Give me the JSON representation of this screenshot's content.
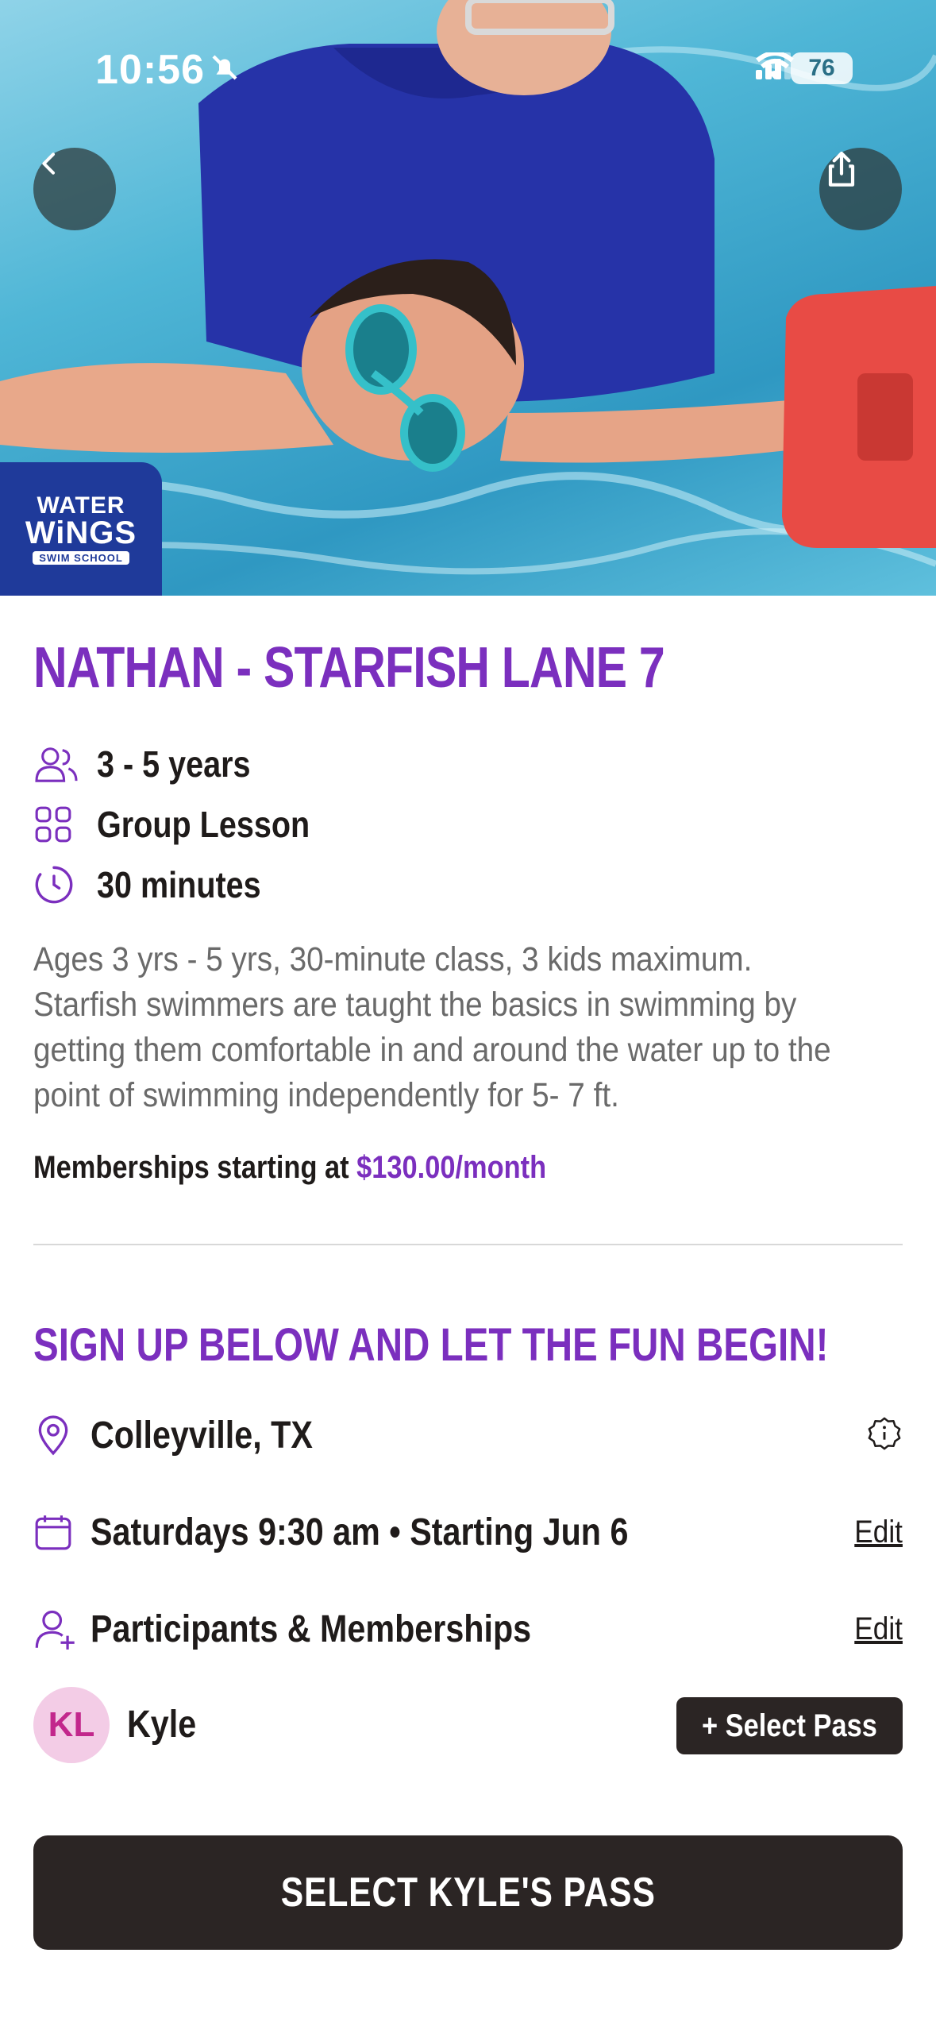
{
  "status_bar": {
    "time": "10:56",
    "battery": "76"
  },
  "hero": {
    "logo_line1": "WATER",
    "logo_line2": "WiNGS",
    "logo_line3": "SWIM SCHOOL"
  },
  "class": {
    "title": "NATHAN - STARFISH LANE 7",
    "age_range": "3 - 5 years",
    "lesson_type": "Group Lesson",
    "duration": "30 minutes",
    "description": "Ages 3 yrs - 5 yrs, 30-minute class, 3 kids maximum. Starfish swimmers are taught the basics in swimming by getting them comfortable in and around the water up to the point of swimming independently for 5- 7 ft.",
    "price_prefix": "Memberships starting at ",
    "price": "$130.00/month"
  },
  "signup": {
    "title": "SIGN UP BELOW AND LET THE FUN BEGIN!",
    "location": "Colleyville, TX",
    "schedule": "Saturdays 9:30 am • Starting Jun 6",
    "schedule_edit": "Edit",
    "participants_label": "Participants & Memberships",
    "participants_edit": "Edit",
    "participant": {
      "initials": "KL",
      "name": "Kyle"
    },
    "select_pass_label": "+ Select Pass",
    "cta_label": "SELECT KYLE'S PASS"
  },
  "colors": {
    "accent": "#7b2fbe",
    "dark_button": "#2b2524",
    "avatar_bg": "#f3cce6",
    "avatar_text": "#c2278c"
  },
  "icons": [
    "back-icon",
    "share-icon",
    "people-icon",
    "grid-icon",
    "clock-icon",
    "location-icon",
    "info-icon",
    "calendar-icon",
    "add-person-icon"
  ]
}
